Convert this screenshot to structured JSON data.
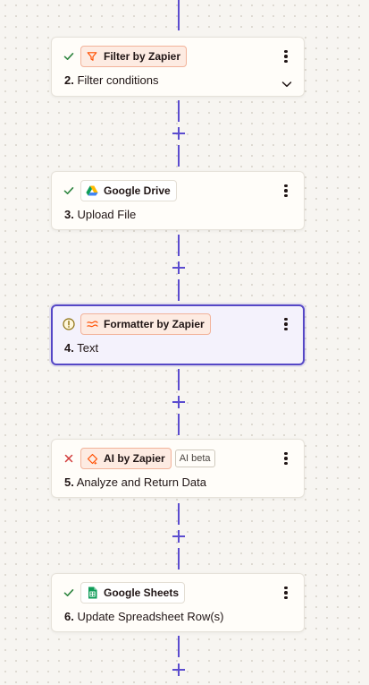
{
  "steps": [
    {
      "number": "2.",
      "title": "Filter conditions",
      "app": "Filter by Zapier",
      "status": "success",
      "app_style": "orange",
      "app_icon": "filter-icon",
      "expandable": true
    },
    {
      "number": "3.",
      "title": "Upload File",
      "app": "Google Drive",
      "status": "success",
      "app_style": "plain",
      "app_icon": "google-drive-icon"
    },
    {
      "number": "4.",
      "title": "Text",
      "app": "Formatter by Zapier",
      "status": "warning",
      "app_style": "orange",
      "app_icon": "formatter-icon",
      "selected": true
    },
    {
      "number": "5.",
      "title": "Analyze and Return Data",
      "app": "AI by Zapier",
      "status": "error",
      "app_style": "orange",
      "app_icon": "ai-icon",
      "badge": "AI beta"
    },
    {
      "number": "6.",
      "title": "Update Spreadsheet Row(s)",
      "app": "Google Sheets",
      "status": "success",
      "app_style": "plain",
      "app_icon": "google-sheets-icon"
    }
  ],
  "colors": {
    "connector": "#5b4ccf",
    "selected_border": "#5547c6",
    "success": "#2e8540",
    "error": "#d23b3b",
    "warning": "#8a6d0b",
    "zapier_orange": "#ff4f00"
  }
}
